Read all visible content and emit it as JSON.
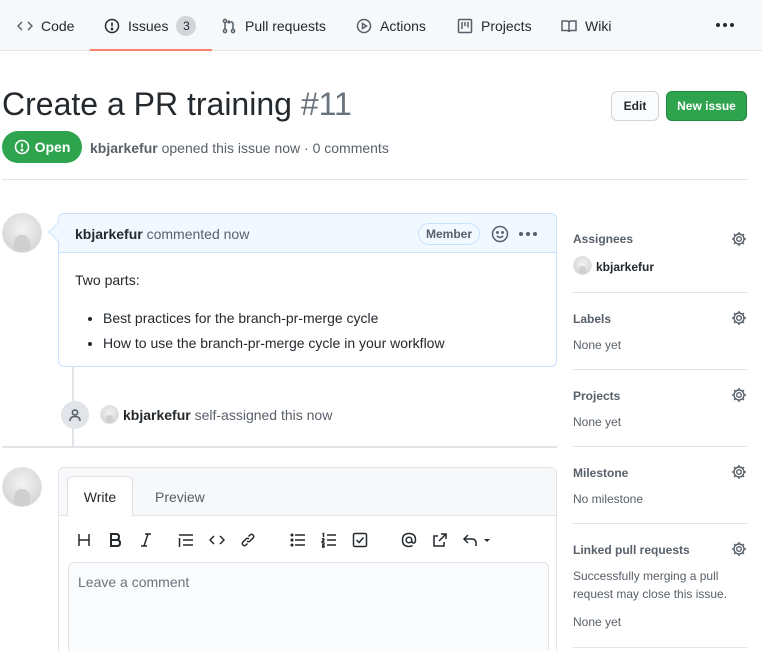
{
  "nav": {
    "tabs": [
      {
        "label": "Code",
        "icon": "code-icon"
      },
      {
        "label": "Issues",
        "icon": "issue-opened-icon",
        "count": "3"
      },
      {
        "label": "Pull requests",
        "icon": "git-pull-request-icon"
      },
      {
        "label": "Actions",
        "icon": "play-icon"
      },
      {
        "label": "Projects",
        "icon": "project-icon"
      },
      {
        "label": "Wiki",
        "icon": "book-icon"
      }
    ]
  },
  "issue": {
    "title": "Create a PR training",
    "number": "#11",
    "state": "Open",
    "author": "kbjarkefur",
    "meta": "opened this issue now · 0 comments"
  },
  "buttons": {
    "edit": "Edit",
    "new_issue": "New issue"
  },
  "comment": {
    "author": "kbjarkefur",
    "action": "commented now",
    "role_badge": "Member",
    "intro": "Two parts:",
    "items": [
      "Best practices for the branch-pr-merge cycle",
      "How to use the branch-pr-merge cycle in your workflow"
    ]
  },
  "event": {
    "actor": "kbjarkefur",
    "action": "self-assigned this now"
  },
  "editor": {
    "tab_write": "Write",
    "tab_preview": "Preview",
    "placeholder": "Leave a comment"
  },
  "sidebar": {
    "assignees": {
      "title": "Assignees",
      "value": "kbjarkefur"
    },
    "labels": {
      "title": "Labels",
      "value": "None yet"
    },
    "projects": {
      "title": "Projects",
      "value": "None yet"
    },
    "milestone": {
      "title": "Milestone",
      "value": "No milestone"
    },
    "linked_prs": {
      "title": "Linked pull requests",
      "line1": "Successfully merging a pull",
      "line2": "request may close this issue.",
      "value": "None yet"
    }
  },
  "colors": {
    "open_green": "#2ea44f",
    "tab_underline": "#f9826c",
    "comment_border": "#c8e1ff"
  }
}
